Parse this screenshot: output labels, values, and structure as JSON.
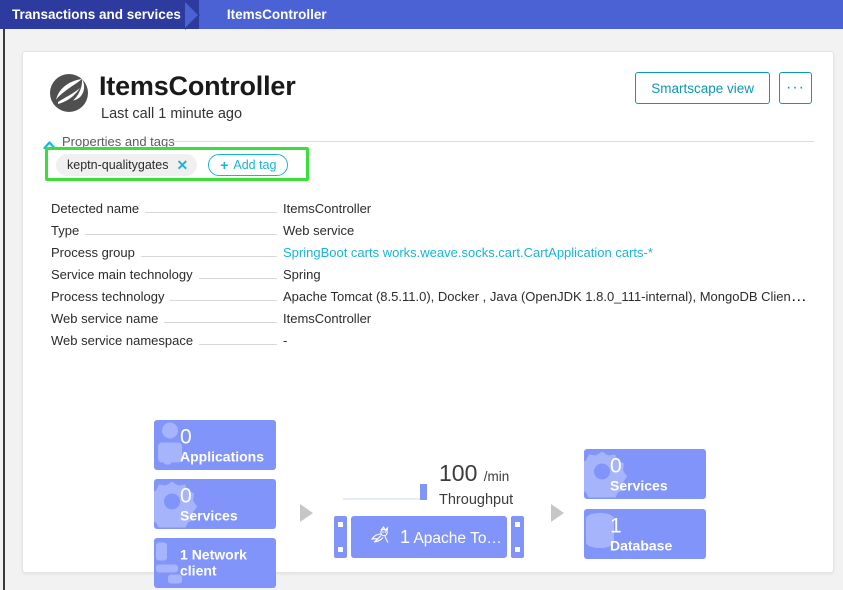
{
  "breadcrumb": {
    "parent": "Transactions and services",
    "current": "ItemsController"
  },
  "header": {
    "logo_icon": "spring-leaf-logo",
    "title": "ItemsController",
    "subtitle": "Last call 1 minute ago",
    "smartscape_label": "Smartscape view",
    "more_label": "···"
  },
  "properties_section": {
    "toggle_label": "Properties and tags",
    "chevron_icon": "chevron-up-icon",
    "highlight_color": "#38e038"
  },
  "tags": {
    "chip_label": "keptn-qualitygates",
    "chip_remove_icon": "✕",
    "add_tag_label": "Add tag",
    "add_tag_plus": "+"
  },
  "properties": [
    {
      "label": "Detected name",
      "value": "ItemsController",
      "link": false
    },
    {
      "label": "Type",
      "value": "Web service",
      "link": false
    },
    {
      "label": "Process group",
      "value": "SpringBoot carts works.weave.socks.cart.CartApplication carts-*",
      "link": true
    },
    {
      "label": "Service main technology",
      "value": "Spring",
      "link": false
    },
    {
      "label": "Process technology",
      "value": "Apache Tomcat (8.5.11.0), Docker , Java (OpenJDK 1.8.0_111-internal), MongoDB Client (driver-core-…",
      "link": false
    },
    {
      "label": "Web service name",
      "value": "ItemsController",
      "link": false
    },
    {
      "label": "Web service namespace",
      "value": "-",
      "link": false
    }
  ],
  "flow": {
    "incoming": [
      {
        "count": "0",
        "label": "Applications",
        "icon": "applications-icon",
        "inline": false
      },
      {
        "count": "0",
        "label": "Services",
        "icon": "services-gear-icon",
        "inline": false
      },
      {
        "count": "1",
        "label": "Network client",
        "icon": "network-client-icon",
        "inline": true
      }
    ],
    "outgoing": [
      {
        "count": "0",
        "label": "Services",
        "icon": "services-gear-icon",
        "inline": false
      },
      {
        "count": "1",
        "label": "Database",
        "icon": "database-icon",
        "inline": false
      }
    ],
    "center": {
      "count": "1",
      "label": "Apache To…",
      "icon": "apache-tomcat-icon"
    },
    "throughput": {
      "value": "100",
      "unit": "/min",
      "label": "Throughput"
    },
    "arrow_icon": "triangle-right-icon",
    "tile_color": "#8094fa"
  }
}
